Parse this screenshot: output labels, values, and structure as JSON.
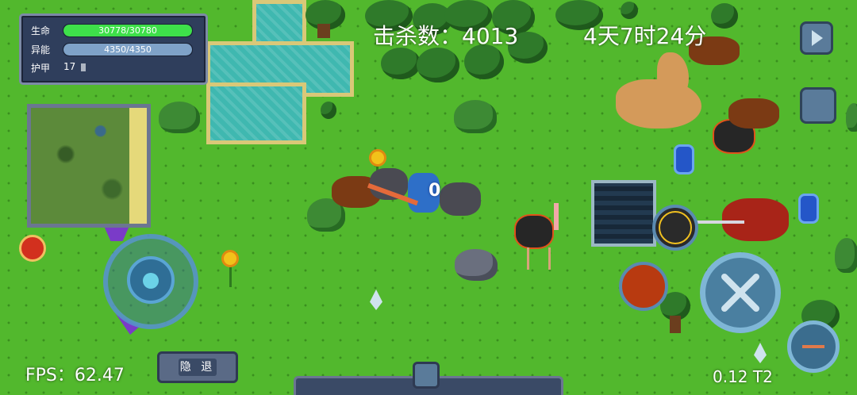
{
  "status": {
    "hp_label": "生命",
    "hp_text": "30778/30780",
    "hp_fraction": 0.9999,
    "energy_label": "异能",
    "energy_text": "4350/4350",
    "energy_fraction": 1.0,
    "armor_label": "护甲",
    "armor_value": "17"
  },
  "hud": {
    "kills_text": "击杀数：4013",
    "time_text": "4天7时24分",
    "fps_text": "FPS：62.47",
    "version_text": "0.12 T2",
    "float_number": "0"
  },
  "buttons": {
    "retreat_label": "隐 退"
  },
  "colors": {
    "hp_bar": "#3ee04a",
    "energy_bar": "#7fa2c8",
    "panel": "#2f3e5c",
    "grass": "#52b82d"
  },
  "icons": [
    "play-icon",
    "backpack-icon",
    "joystick-icon",
    "sword-attack-icon",
    "summon-skill-icon",
    "fire-skill-icon",
    "weapon-switch-icon",
    "potion-icon"
  ]
}
